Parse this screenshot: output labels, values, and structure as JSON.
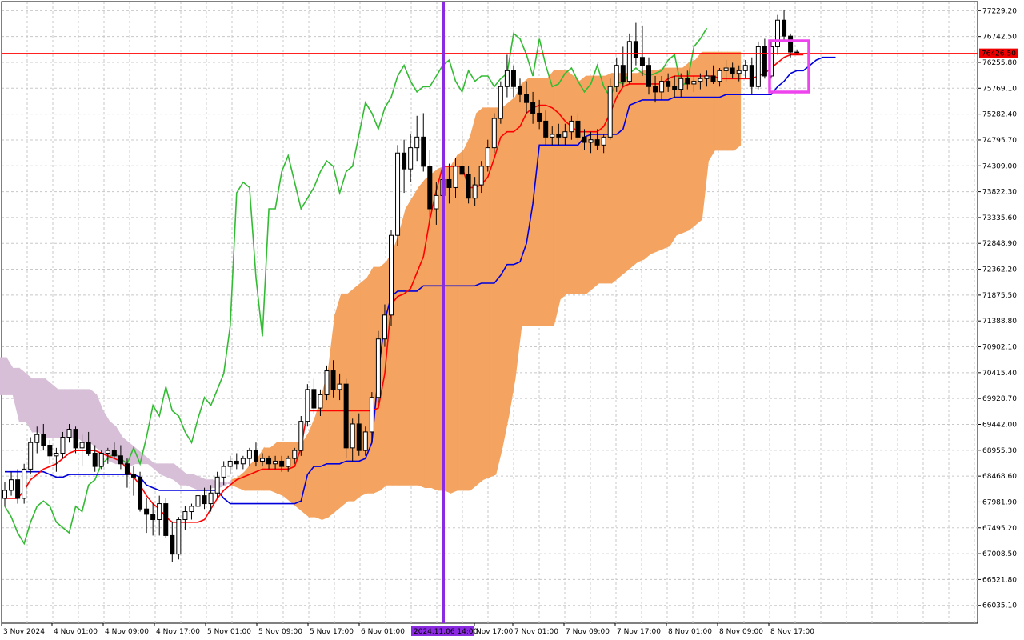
{
  "chart_data": {
    "type": "candlestick",
    "instrument_price_label": "76426.50",
    "cursor_time_label": "2024.11.06 14:00",
    "ylim": [
      65700,
      77400
    ],
    "y_ticks": [
      "77229.20",
      "76742.50",
      "76255.80",
      "75769.10",
      "75282.40",
      "74795.70",
      "74309.00",
      "73822.30",
      "73335.60",
      "72848.90",
      "72362.20",
      "71875.50",
      "71388.80",
      "70902.10",
      "70415.40",
      "69928.70",
      "69442.00",
      "68955.30",
      "68468.60",
      "67981.90",
      "67495.20",
      "67008.50",
      "66521.80",
      "66035.10"
    ],
    "x_ticks": [
      "3 Nov 2024",
      "4 Nov 01:00",
      "4 Nov 09:00",
      "4 Nov 17:00",
      "5 Nov 01:00",
      "5 Nov 09:00",
      "5 Nov 17:00",
      "6 Nov 01:00",
      "",
      "Nov 17:00",
      "7 Nov 01:00",
      "7 Nov 09:00",
      "7 Nov 17:00",
      "8 Nov 01:00",
      "8 Nov 09:00",
      "8 Nov 17:00"
    ],
    "colors": {
      "kijun": "#ff0000",
      "tenkan": "#0000dd",
      "chikou": "#33bb33",
      "cloud_bull": "#f4a460",
      "cloud_bear": "#d8bfd8",
      "cursor_line": "#8a2be2",
      "highlight_box": "#ee44ee",
      "price_line": "#ff0000",
      "price_label_bg": "#ee0000"
    },
    "candles": [
      [
        68050,
        68350,
        67900,
        68200
      ],
      [
        68200,
        68550,
        68100,
        68400
      ],
      [
        68400,
        68600,
        67950,
        68050
      ],
      [
        68050,
        68700,
        67950,
        68600
      ],
      [
        68600,
        69200,
        68500,
        69100
      ],
      [
        69100,
        69400,
        68900,
        69250
      ],
      [
        69250,
        69450,
        68950,
        69050
      ],
      [
        69050,
        69150,
        68700,
        68850
      ],
      [
        68850,
        69000,
        68550,
        68900
      ],
      [
        68900,
        69300,
        68800,
        69200
      ],
      [
        69200,
        69450,
        69100,
        69350
      ],
      [
        69350,
        69400,
        68900,
        69000
      ],
      [
        69000,
        69250,
        68650,
        69100
      ],
      [
        69100,
        69300,
        68850,
        68900
      ],
      [
        68900,
        69050,
        68550,
        68650
      ],
      [
        68650,
        68950,
        68600,
        68900
      ],
      [
        68900,
        69000,
        68700,
        68950
      ],
      [
        68950,
        69100,
        68800,
        68850
      ],
      [
        68850,
        69050,
        68600,
        68700
      ],
      [
        68700,
        68800,
        68250,
        68500
      ],
      [
        68500,
        68650,
        68100,
        68450
      ],
      [
        68450,
        68550,
        67800,
        67850
      ],
      [
        67850,
        68050,
        67400,
        67750
      ],
      [
        67750,
        67950,
        67350,
        67650
      ],
      [
        67650,
        68100,
        67350,
        67950
      ],
      [
        67950,
        68050,
        67300,
        67350
      ],
      [
        67350,
        67600,
        66850,
        67000
      ],
      [
        67000,
        67700,
        66900,
        67650
      ],
      [
        67650,
        67900,
        67450,
        67800
      ],
      [
        67800,
        67950,
        67650,
        67900
      ],
      [
        67900,
        68200,
        67700,
        68100
      ],
      [
        68100,
        68250,
        67850,
        67950
      ],
      [
        67950,
        68300,
        67800,
        68150
      ],
      [
        68150,
        68550,
        68050,
        68450
      ],
      [
        68450,
        68750,
        68300,
        68650
      ],
      [
        68650,
        68850,
        68500,
        68750
      ],
      [
        68750,
        68900,
        68600,
        68700
      ],
      [
        68700,
        68850,
        68600,
        68800
      ],
      [
        68800,
        69000,
        68650,
        68950
      ],
      [
        68950,
        69100,
        68650,
        68750
      ],
      [
        68750,
        68900,
        68650,
        68800
      ],
      [
        68800,
        68850,
        68600,
        68700
      ],
      [
        68700,
        68850,
        68600,
        68750
      ],
      [
        68750,
        68850,
        68550,
        68650
      ],
      [
        68650,
        68850,
        68550,
        68800
      ],
      [
        68800,
        69000,
        68700,
        68950
      ],
      [
        68950,
        69600,
        68850,
        69500
      ],
      [
        69500,
        70200,
        69400,
        70100
      ],
      [
        70100,
        70300,
        69650,
        69750
      ],
      [
        69750,
        70100,
        69600,
        70000
      ],
      [
        70000,
        70550,
        69900,
        70450
      ],
      [
        70450,
        70650,
        69950,
        70100
      ],
      [
        70100,
        70400,
        69900,
        70200
      ],
      [
        70200,
        70300,
        68800,
        69000
      ],
      [
        69000,
        69550,
        68750,
        69450
      ],
      [
        69450,
        69650,
        68850,
        68950
      ],
      [
        68950,
        69400,
        68850,
        69300
      ],
      [
        69300,
        70050,
        69100,
        69950
      ],
      [
        69950,
        71200,
        69850,
        71050
      ],
      [
        71050,
        71700,
        70900,
        71500
      ],
      [
        71500,
        73100,
        71300,
        73000
      ],
      [
        73000,
        74700,
        72800,
        74550
      ],
      [
        74550,
        74800,
        73800,
        74250
      ],
      [
        74250,
        74900,
        74000,
        74650
      ],
      [
        74650,
        75250,
        74400,
        74850
      ],
      [
        74850,
        75300,
        74200,
        74300
      ],
      [
        74300,
        74600,
        73250,
        73500
      ],
      [
        73500,
        74000,
        73200,
        73750
      ],
      [
        73750,
        74200,
        73500,
        74050
      ],
      [
        74050,
        74350,
        73600,
        73900
      ],
      [
        73900,
        74450,
        73700,
        74300
      ],
      [
        74300,
        74900,
        74100,
        74150
      ],
      [
        74150,
        74300,
        73600,
        73700
      ],
      [
        73700,
        74100,
        73550,
        73950
      ],
      [
        73950,
        74400,
        73800,
        74300
      ],
      [
        74300,
        74800,
        74200,
        74650
      ],
      [
        74650,
        75300,
        74550,
        75200
      ],
      [
        75200,
        75900,
        75100,
        75800
      ],
      [
        75800,
        76400,
        75600,
        76100
      ],
      [
        76100,
        76200,
        75600,
        75800
      ],
      [
        75800,
        75950,
        75500,
        75650
      ],
      [
        75650,
        75900,
        75300,
        75500
      ],
      [
        75500,
        75700,
        75100,
        75300
      ],
      [
        75300,
        75550,
        75000,
        75150
      ],
      [
        75150,
        75350,
        74700,
        74850
      ],
      [
        74850,
        75050,
        74700,
        74900
      ],
      [
        74900,
        75100,
        74700,
        74850
      ],
      [
        74850,
        75100,
        74700,
        74950
      ],
      [
        74950,
        75250,
        74800,
        75150
      ],
      [
        75150,
        75300,
        74750,
        74850
      ],
      [
        74850,
        75000,
        74600,
        74750
      ],
      [
        74750,
        74950,
        74550,
        74800
      ],
      [
        74800,
        75000,
        74600,
        74700
      ],
      [
        74700,
        74900,
        74550,
        74850
      ],
      [
        74850,
        75950,
        74800,
        75800
      ],
      [
        75800,
        76350,
        75700,
        76200
      ],
      [
        76200,
        76550,
        75800,
        75900
      ],
      [
        75900,
        76800,
        75850,
        76650
      ],
      [
        76650,
        77000,
        76200,
        76350
      ],
      [
        76350,
        76950,
        76000,
        76200
      ],
      [
        76200,
        76350,
        75650,
        75800
      ],
      [
        75800,
        76000,
        75500,
        75700
      ],
      [
        75700,
        76000,
        75550,
        75900
      ],
      [
        75900,
        76050,
        75700,
        75800
      ],
      [
        75800,
        76000,
        75600,
        75750
      ],
      [
        75750,
        76050,
        75600,
        75950
      ],
      [
        75950,
        76100,
        75750,
        75850
      ],
      [
        75850,
        76000,
        75700,
        75900
      ],
      [
        75900,
        76050,
        75750,
        75950
      ],
      [
        75950,
        76100,
        75800,
        76000
      ],
      [
        76000,
        76200,
        75850,
        75900
      ],
      [
        75900,
        76150,
        75800,
        76100
      ],
      [
        76100,
        76300,
        75900,
        76150
      ],
      [
        76150,
        76250,
        75950,
        76050
      ],
      [
        76050,
        76200,
        75900,
        76100
      ],
      [
        76100,
        76300,
        75950,
        76200
      ],
      [
        76200,
        76350,
        75650,
        75800
      ],
      [
        75800,
        76650,
        75750,
        76550
      ],
      [
        76550,
        76700,
        75950,
        76000
      ],
      [
        76000,
        76650,
        75950,
        76550
      ],
      [
        76550,
        77150,
        76400,
        77050
      ],
      [
        77050,
        77250,
        76650,
        76750
      ],
      [
        76750,
        76800,
        76350,
        76450
      ],
      [
        76450,
        76500,
        76400,
        76426
      ]
    ],
    "kijun": [
      68050,
      68050,
      68050,
      68200,
      68400,
      68500,
      68600,
      68650,
      68700,
      68800,
      68900,
      68950,
      68950,
      68950,
      68950,
      68900,
      68850,
      68800,
      68750,
      68600,
      68450,
      68300,
      68100,
      67950,
      67850,
      67700,
      67600,
      67600,
      67600,
      67600,
      67600,
      67650,
      67850,
      68050,
      68200,
      68300,
      68400,
      68450,
      68500,
      68550,
      68600,
      68600,
      68600,
      68600,
      68600,
      68650,
      69000,
      69700,
      69700,
      69700,
      69700,
      69700,
      69700,
      69700,
      69700,
      69700,
      69700,
      69700,
      69750,
      70400,
      71700,
      71850,
      71900,
      72000,
      72300,
      72600,
      73300,
      73850,
      74300,
      74300,
      74300,
      74300,
      73900,
      73900,
      73950,
      74100,
      74450,
      74850,
      74950,
      74950,
      75050,
      75300,
      75400,
      75450,
      75450,
      75400,
      75300,
      75150,
      75050,
      74950,
      74950,
      74950,
      74950,
      75050,
      75300,
      75600,
      75800,
      75850,
      75850,
      75850,
      75850,
      75850,
      75850,
      75950,
      76000,
      76000,
      76000,
      76000,
      76000,
      76000,
      76000,
      75950,
      75950,
      75950,
      75950,
      75950,
      75950,
      76000,
      76050,
      76150,
      76250,
      76350,
      76400,
      76400,
      76400
    ],
    "tenkan": [
      68550,
      68550,
      68550,
      68550,
      68550,
      68550,
      68550,
      68500,
      68450,
      68450,
      68500,
      68500,
      68500,
      68500,
      68500,
      68500,
      68500,
      68500,
      68500,
      68500,
      68500,
      68450,
      68300,
      68250,
      68200,
      68200,
      68200,
      68200,
      68200,
      68200,
      68200,
      68200,
      68200,
      68200,
      68050,
      67950,
      67950,
      67950,
      67950,
      67950,
      67950,
      67950,
      67950,
      67950,
      67950,
      67950,
      68000,
      68500,
      68650,
      68650,
      68700,
      68700,
      68700,
      68750,
      68750,
      68750,
      68800,
      69100,
      70400,
      71400,
      71850,
      71950,
      71950,
      71950,
      71950,
      72050,
      72050,
      72050,
      72050,
      72050,
      72050,
      72050,
      72050,
      72050,
      72100,
      72100,
      72100,
      72250,
      72450,
      72450,
      72500,
      72850,
      73600,
      74700,
      74700,
      74700,
      74700,
      74700,
      74700,
      74700,
      74850,
      74900,
      74900,
      74900,
      74900,
      74900,
      75000,
      75450,
      75500,
      75550,
      75550,
      75550,
      75550,
      75550,
      75600,
      75600,
      75600,
      75600,
      75600,
      75600,
      75600,
      75600,
      75650,
      75650,
      75650,
      75650,
      75650,
      75650,
      75650,
      75650,
      75800,
      75900,
      76050,
      76100,
      76100,
      76200,
      76300,
      76350,
      76350,
      76350
    ],
    "chikou": [
      67900,
      67700,
      67400,
      67200,
      67600,
      67900,
      68000,
      67900,
      67600,
      67500,
      67400,
      67900,
      67800,
      68300,
      68400,
      68700,
      68800,
      68900,
      68800,
      68700,
      69000,
      68700,
      69200,
      69800,
      69600,
      70150,
      69700,
      69600,
      69300,
      69100,
      69550,
      69950,
      69800,
      70100,
      70400,
      71300,
      73800,
      74000,
      73900,
      72200,
      71100,
      73500,
      73500,
      74200,
      74500,
      74000,
      73500,
      73700,
      73900,
      74200,
      74400,
      74300,
      73800,
      74200,
      74300,
      74900,
      75500,
      75300,
      75000,
      75400,
      75600,
      76000,
      76200,
      75900,
      75700,
      75800,
      75800,
      76000,
      76200,
      76300,
      75900,
      75700,
      76100,
      75900,
      76000,
      76000,
      75800,
      75950,
      76050,
      76800,
      76700,
      76400,
      76000,
      76700,
      76200,
      75800,
      75850,
      76050,
      76150,
      75900,
      75700,
      75850,
      76200,
      75800,
      75600,
      75900,
      75850,
      76050,
      76150,
      76050,
      76000,
      76050,
      76100,
      76300,
      76400,
      75800,
      75900,
      76550,
      76700,
      76900
    ],
    "span_a": [
      70000,
      70000,
      70000,
      69500,
      69500,
      69300,
      69300,
      69200,
      69200,
      69200,
      69200,
      69200,
      69200,
      69100,
      69100,
      69000,
      68900,
      68750,
      68700,
      68700,
      68650,
      68700,
      68700,
      68700,
      68600,
      68500,
      68450,
      68400,
      68300,
      68300,
      68250,
      68200,
      68200,
      68250,
      68250,
      68300,
      68400,
      68450,
      68550,
      68700,
      68800,
      69000,
      69000,
      69100,
      69100,
      69100,
      69100,
      69100,
      69300,
      69600,
      70000,
      70500,
      71500,
      71900,
      71900,
      72000,
      72100,
      72200,
      72400,
      72400,
      72500,
      72700,
      73050,
      73500,
      73700,
      73900,
      74050,
      74150,
      74250,
      74300,
      74300,
      74500,
      74600,
      74850,
      75300,
      75400,
      75400,
      75400,
      75400,
      75500,
      75600,
      75850,
      75950,
      75950,
      75950,
      75950,
      76100,
      76100,
      76100,
      76000,
      75900,
      76000,
      76000,
      76000,
      76000,
      76050,
      76050,
      76050,
      76050,
      76050,
      76100,
      76100,
      76100,
      76150,
      76150,
      76150,
      76150,
      76250,
      76300,
      76450,
      76450,
      76450,
      76450,
      76450,
      76450,
      76450
    ],
    "span_b": [
      70700,
      70700,
      70500,
      70500,
      70400,
      70300,
      70300,
      70300,
      70200,
      70100,
      70100,
      70100,
      70100,
      70100,
      70100,
      70000,
      69700,
      69500,
      69400,
      69200,
      69100,
      69000,
      68900,
      68800,
      68700,
      68700,
      68700,
      68700,
      68600,
      68500,
      68500,
      68450,
      68400,
      68400,
      68350,
      68350,
      68300,
      68250,
      68200,
      68200,
      68200,
      68200,
      68200,
      68150,
      68100,
      68000,
      67900,
      67800,
      67700,
      67700,
      67650,
      67700,
      67800,
      67900,
      68000,
      68000,
      68100,
      68150,
      68150,
      68200,
      68300,
      68300,
      68300,
      68300,
      68300,
      68300,
      68250,
      68250,
      68200,
      68200,
      68150,
      68200,
      68200,
      68200,
      68300,
      68400,
      68450,
      68500,
      69000,
      69600,
      70300,
      71300,
      71300,
      71300,
      71300,
      71300,
      71300,
      71800,
      71900,
      71900,
      71900,
      71900,
      72000,
      72100,
      72100,
      72100,
      72200,
      72300,
      72400,
      72500,
      72550,
      72650,
      72700,
      72750,
      72800,
      73000,
      73050,
      73100,
      73200,
      73300,
      74400,
      74600,
      74600,
      74600,
      74600,
      74700
    ]
  }
}
